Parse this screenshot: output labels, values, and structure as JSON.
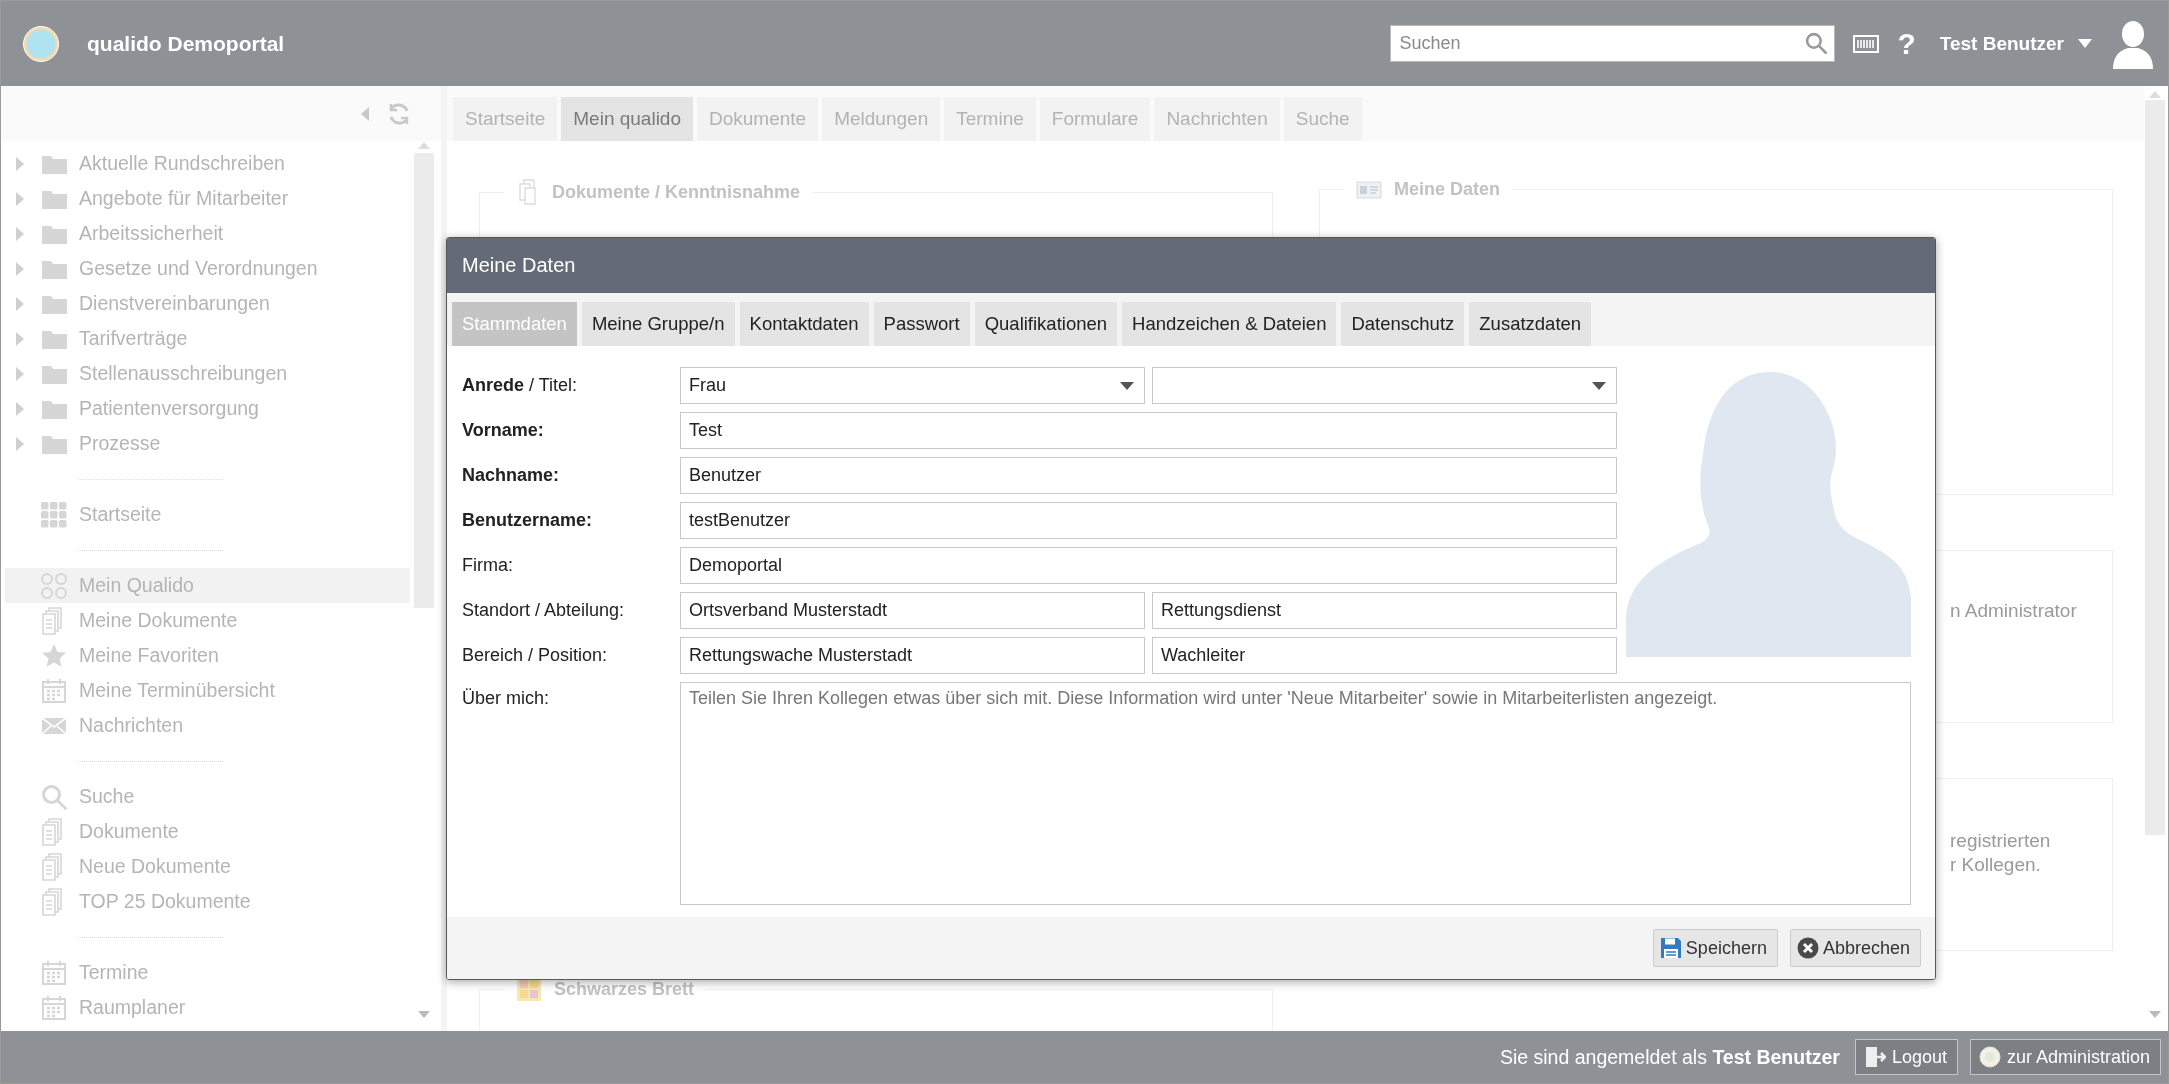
{
  "header": {
    "title": "qualido Demoportal",
    "search": {
      "placeholder": "Suchen"
    },
    "help": "?",
    "user": "Test Benutzer"
  },
  "sidebar": {
    "groups": [
      {
        "items": [
          {
            "kind": "folder",
            "label": "Aktuelle Rundschreiben",
            "expanded": false,
            "selected": false
          },
          {
            "kind": "folder",
            "label": "Angebote für Mitarbeiter",
            "expanded": false,
            "selected": false
          },
          {
            "kind": "folder",
            "label": "Arbeitssicherheit",
            "expanded": false,
            "selected": false
          },
          {
            "kind": "folder",
            "label": "Gesetze und Verordnungen",
            "expanded": false,
            "selected": false
          },
          {
            "kind": "folder",
            "label": "Dienstvereinbarungen",
            "expanded": false,
            "selected": false
          },
          {
            "kind": "folder",
            "label": "Tarifverträge",
            "expanded": false,
            "selected": false
          },
          {
            "kind": "folder",
            "label": "Stellenausschreibungen",
            "expanded": false,
            "selected": false
          },
          {
            "kind": "folder",
            "label": "Patientenversorgung",
            "expanded": false,
            "selected": false
          },
          {
            "kind": "folder",
            "label": "Prozesse",
            "expanded": false,
            "selected": false
          }
        ]
      },
      {
        "items": [
          {
            "kind": "grid",
            "label": "Startseite",
            "selected": false
          }
        ]
      },
      {
        "items": [
          {
            "kind": "circles",
            "label": "Mein Qualido",
            "selected": true
          },
          {
            "kind": "docs",
            "label": "Meine Dokumente",
            "selected": false
          },
          {
            "kind": "star",
            "label": "Meine Favoriten",
            "selected": false
          },
          {
            "kind": "calendar",
            "label": "Meine Terminübersicht",
            "selected": false
          },
          {
            "kind": "mail",
            "label": "Nachrichten",
            "selected": false
          }
        ]
      },
      {
        "items": [
          {
            "kind": "search",
            "label": "Suche",
            "selected": false
          },
          {
            "kind": "docs",
            "label": "Dokumente",
            "selected": false
          },
          {
            "kind": "docs",
            "label": "Neue Dokumente",
            "selected": false
          },
          {
            "kind": "docs",
            "label": "TOP 25 Dokumente",
            "selected": false
          }
        ]
      },
      {
        "items": [
          {
            "kind": "calendar",
            "label": "Termine",
            "selected": false
          },
          {
            "kind": "calendar",
            "label": "Raumplaner",
            "selected": false
          }
        ]
      }
    ]
  },
  "tabs": [
    {
      "label": "Startseite",
      "selected": false
    },
    {
      "label": "Mein qualido",
      "selected": true
    },
    {
      "label": "Dokumente",
      "selected": false
    },
    {
      "label": "Meldungen",
      "selected": false
    },
    {
      "label": "Termine",
      "selected": false
    },
    {
      "label": "Formulare",
      "selected": false
    },
    {
      "label": "Nachrichten",
      "selected": false
    },
    {
      "label": "Suche",
      "selected": false
    }
  ],
  "panels": {
    "left": [
      {
        "kind": "docs",
        "title": "Dokumente / Kenntnisnahme"
      },
      {
        "kind": "board",
        "title": "Schwarzes Brett"
      }
    ],
    "right": [
      {
        "kind": "card",
        "title": "Meine Daten"
      },
      {
        "lines": [
          "n Administrator"
        ]
      },
      {
        "lines": [
          "registrierten",
          "r Kollegen."
        ]
      }
    ]
  },
  "dialog": {
    "title": "Meine Daten",
    "tabs": [
      {
        "label": "Stammdaten",
        "selected": true
      },
      {
        "label": "Meine Gruppe/n",
        "selected": false
      },
      {
        "label": "Kontaktdaten",
        "selected": false
      },
      {
        "label": "Passwort",
        "selected": false
      },
      {
        "label": "Qualifikationen",
        "selected": false
      },
      {
        "label": "Handzeichen & Dateien",
        "selected": false
      },
      {
        "label": "Datenschutz",
        "selected": false
      },
      {
        "label": "Zusatzdaten",
        "selected": false
      }
    ],
    "form": [
      {
        "label": "**Anrede** / Titel:",
        "bold": false,
        "fields": [
          {
            "kind": "select",
            "value": "Frau"
          },
          {
            "kind": "select"
          }
        ]
      },
      {
        "label": "Vorname:",
        "bold": true,
        "fields": [
          {
            "kind": "text",
            "value": "Test"
          }
        ]
      },
      {
        "label": "Nachname:",
        "bold": true,
        "fields": [
          {
            "kind": "text",
            "value": "Benutzer"
          }
        ]
      },
      {
        "label": "Benutzername:",
        "bold": true,
        "fields": [
          {
            "kind": "text",
            "value": "testBenutzer"
          }
        ]
      },
      {
        "label": "Firma:",
        "bold": false,
        "fields": [
          {
            "kind": "text",
            "value": "Demoportal"
          }
        ]
      },
      {
        "label": "Standort / Abteilung:",
        "bold": false,
        "fields": [
          {
            "kind": "text",
            "value": "Ortsverband Musterstadt"
          },
          {
            "kind": "text",
            "value": "Rettungsdienst"
          }
        ]
      },
      {
        "label": "Bereich / Position:",
        "bold": false,
        "fields": [
          {
            "kind": "text",
            "value": "Rettungswache Musterstadt"
          },
          {
            "kind": "text",
            "value": "Wachleiter"
          }
        ]
      },
      {
        "label": "Über mich:",
        "bold": false,
        "fields": [
          {
            "kind": "textarea",
            "placeholder": "Teilen Sie Ihren Kollegen etwas über sich mit. Diese Information wird unter 'Neue Mitarbeiter' sowie in Mitarbeiterlisten angezeigt."
          }
        ]
      }
    ],
    "buttons": [
      {
        "kind": "save",
        "label": "Speichern"
      },
      {
        "kind": "cancel",
        "label": "Abbrechen"
      }
    ]
  },
  "footer": {
    "text": "Sie sind angemeldet als **Test Benutzer**",
    "buttons": [
      {
        "kind": "logout",
        "label": "Logout"
      },
      {
        "kind": "admin",
        "label": "zur Administration"
      }
    ]
  }
}
